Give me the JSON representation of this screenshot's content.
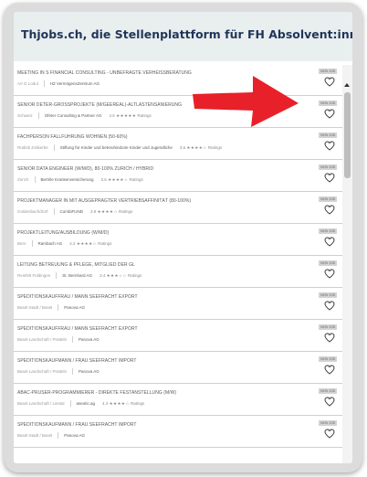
{
  "header": {
    "site_title": "Thjobs.ch, die Stellenplattform für FH Absolvent:innen"
  },
  "badge_label": "NEW JOB",
  "jobs": [
    {
      "title": "MEETING IN S FINANCIAL CONSULTING - UNBEFRAGTE VERHEISSBERATUNG",
      "location": "Arr D Lodul",
      "company": "HZ VermögensZentrum AG",
      "rating": "",
      "stars": ""
    },
    {
      "title": "SENIOR DETER-GROSSPROJEKTE (M/GEEREAL)-ALTLASTENSANIERUNG",
      "location": "Schweiz",
      "company": "Ofeter Consulting & Partner AG",
      "rating": "4.6",
      "stars": "★★★★★",
      "reviews": "Ratings"
    },
    {
      "title": "FACHPERSON FALLFUHRUNG WOHNEN (50-60%)",
      "location": "Rüdiöti Zolikerbe",
      "company": "Stiftung für Kinder und betreuhindorie Kinder und Jugendliche",
      "rating": "3.6",
      "stars": "★★★★☆",
      "reviews": "Ratings"
    },
    {
      "title": "SENIOR DATA ENGINEER (W/M/D), 80-100% ZÜRICH / HYBRID",
      "location": "Zürich",
      "company": "Bertrile Krankenversicherung",
      "rating": "3.6",
      "stars": "★★★★☆",
      "reviews": "Ratings"
    },
    {
      "title": "PROJEKTMANAGER IN MIT AUSGEPRÄGTER VERTRIEBSAFFINITÄT (80-100%)",
      "location": "Goldenbach/Zürf",
      "company": "CombiFUND",
      "rating": "3.9",
      "stars": "★★★★☆",
      "reviews": "Ratings"
    },
    {
      "title": "PROJEKTLEITUNG/AUSBILDUNG (W/M/D)",
      "location": "Bern",
      "company": "Rambach AG",
      "rating": "4.2",
      "stars": "★★★★☆",
      "reviews": "Ratings"
    },
    {
      "title": "LEITUNG BETREUUNG & PFLEGE, MITGLIED DER GL",
      "location": "Reinfelt Feldingen",
      "company": "St. Bernhard AG",
      "rating": "3.4",
      "stars": "★★★☆☆",
      "reviews": "Ratings"
    },
    {
      "title": "SPEDITIONSKAUFFRAU / MANN SEEFRACHT EXPORT",
      "location": "Basel-Stadt / Basel",
      "company": "Panova AG",
      "rating": "",
      "stars": ""
    },
    {
      "title": "SPEDITIONSKAUFFRAU / MANN SEEFRACHT EXPORT",
      "location": "Basel-Landschaft / Pratteln",
      "company": "Panova AG",
      "rating": "",
      "stars": ""
    },
    {
      "title": "SPEDITIONSKAUFMANN / FRAU SEEFRACHT IMPORT",
      "location": "Basel-Landschaft / Pratteln",
      "company": "Panova AG",
      "rating": "",
      "stars": ""
    },
    {
      "title": "ABAC-PRÜSER-PROGRAMMIERER - DIREKTE FESTANSTELLUNG (M/W)",
      "location": "Basel-Landschaft / Liestal",
      "company": "aseotic.ag",
      "rating": "4.4",
      "stars": "★★★★☆",
      "reviews": "Ratings"
    },
    {
      "title": "SPEDITIONSKAUFMANN / FRAU SEEFRACHT IMPORT",
      "location": "Basel-Stadt / Basel",
      "company": "Panova AG",
      "rating": "",
      "stars": ""
    }
  ],
  "colors": {
    "title": "#1f3558",
    "annotation_arrow": "#e8202a"
  },
  "icons": {
    "favorite": "heart-outline-icon",
    "annotation": "red-arrow-icon"
  }
}
